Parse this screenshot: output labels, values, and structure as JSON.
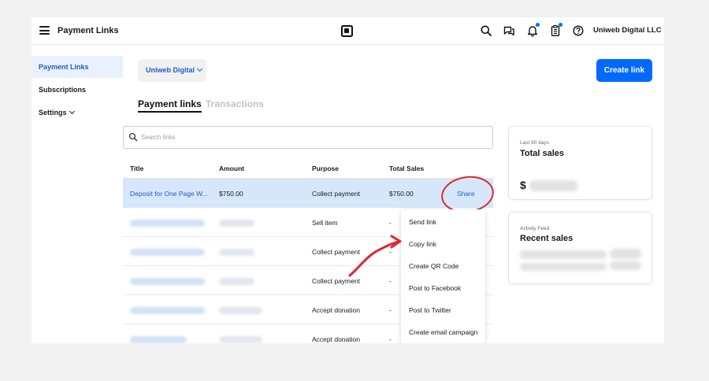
{
  "header": {
    "title": "Payment Links",
    "org": "Uniweb Digital LLC",
    "icons": [
      "search-icon",
      "messages-icon",
      "bell-icon",
      "clipboard-icon",
      "help-icon"
    ],
    "accent": "#006aff"
  },
  "sidebar": {
    "items": [
      {
        "label": "Payment Links",
        "active": true
      },
      {
        "label": "Subscriptions"
      },
      {
        "label": "Settings"
      }
    ]
  },
  "main": {
    "filter_label": "Uniweb Digital",
    "create_button": "Create link",
    "tabs": [
      {
        "label": "Payment links",
        "active": true
      },
      {
        "label": "Transactions"
      }
    ],
    "search_placeholder": "Search links",
    "columns": [
      "Title",
      "Amount",
      "Purpose",
      "Total Sales"
    ],
    "rows": [
      {
        "title": "Deposit for One Page W...",
        "amount": "$750.00",
        "purpose": "Collect payment",
        "total": "$750.00",
        "action": "Share"
      },
      {
        "title": "",
        "amount": "",
        "purpose": "Sell item",
        "total": "-"
      },
      {
        "title": "",
        "amount": "",
        "purpose": "Collect payment",
        "total": "-"
      },
      {
        "title": "",
        "amount": "",
        "purpose": "Collect payment",
        "total": "-"
      },
      {
        "title": "",
        "amount": "",
        "purpose": "Accept donation",
        "total": "-"
      },
      {
        "title": "",
        "amount": "",
        "purpose": "Accept donation",
        "total": "-"
      }
    ]
  },
  "share_menu": {
    "items": [
      "Send link",
      "Copy link",
      "Create QR Code",
      "Post to Facebook",
      "Post to Twitter",
      "Create email campaign"
    ]
  },
  "cards": {
    "sales": {
      "period": "Last 90 days",
      "title": "Total sales",
      "currency": "$"
    },
    "feed": {
      "label": "Activity Feed",
      "title": "Recent sales"
    }
  },
  "annotation_color": "#e0262f"
}
